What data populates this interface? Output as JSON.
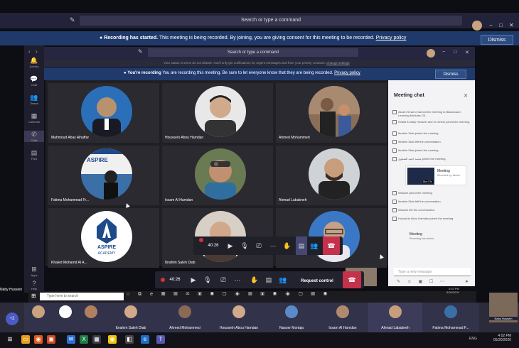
{
  "outer_window": {
    "search_placeholder": "Search or type a command",
    "banner_title": "Recording has started.",
    "banner_text": "This meeting is being recorded. By joining, you are giving consent for this meeting to be recorded.",
    "banner_link": "Privacy policy",
    "dismiss_label": "Dismiss",
    "rail": [
      {
        "icon": "bell-icon",
        "label": "Activity"
      },
      {
        "icon": "chat-icon",
        "label": "Chat"
      },
      {
        "icon": "teams-icon",
        "label": "Teams"
      },
      {
        "icon": "calendar-icon",
        "label": "Calendar"
      },
      {
        "icon": "calls-icon",
        "label": "Calls"
      },
      {
        "icon": "files-icon",
        "label": "Files"
      },
      {
        "icon": "apps-icon",
        "label": "Apps"
      },
      {
        "icon": "help-icon",
        "label": "Help"
      }
    ],
    "user_label": "Naby Hussein"
  },
  "inner_window": {
    "search_placeholder": "Search or type a command",
    "notice_text": "Your status is set to do not disturb. You'll only get notifications for urgent messages and from your priority contacts.",
    "notice_link": "Change settings",
    "banner_title": "You're recording",
    "banner_text": "You are recording this meeting. Be sure to let everyone know that they are being recorded.",
    "banner_link": "Privacy policy",
    "dismiss_label": "Dismiss"
  },
  "participants": [
    {
      "name": "Mahmoud Abas Alhaffar",
      "skin": "#b8926e",
      "bg": "#2a6fb8"
    },
    {
      "name": "Housseïn Abou Hamdan",
      "skin": "#d0aa8a",
      "bg": "#e8e8e8"
    },
    {
      "name": "Ahmed Mohammed",
      "skin": "#7a5a44",
      "bg": "#8a6e58"
    },
    {
      "name": "Fatima Mohammad Fr...",
      "skin": "#222222",
      "bg": "#3a6fa8"
    },
    {
      "name": "Issam Al Hamdan",
      "skin": "#c09070",
      "bg": "#6a7a52"
    },
    {
      "name": "Ahmad Lababneh",
      "skin": "#c79d7c",
      "bg": "#cfd3d6"
    },
    {
      "name": "Khaled Mohamd Al A...",
      "skin": "#ffffff",
      "bg": "#ffffff"
    },
    {
      "name": "Ibrahim Saleh Diab",
      "skin": "#d2a88a",
      "bg": "#d8cfc6"
    },
    {
      "name": "",
      "skin": "#c7a085",
      "bg": "#3a78c6"
    }
  ],
  "aspire_logo": {
    "line1": "ASPIRE",
    "line2": "ACADEMY"
  },
  "chat": {
    "title": "Meeting chat",
    "items": [
      "Akram Smair renamed the meeting to Blackboard Learning Modules G3.",
      "Khalid A.Naby Hussein and 21 others joined the meeting.",
      "Ibrahim Diab joined the meeting.",
      "Ibrahim Diab left the conversation.",
      "Ibrahim Diab joined the meeting.",
      "محمد احمد الصناوي joined the meeting.",
      "Wassim joined the meeting.",
      "Ibrahim Diab left the conversation.",
      "Wassim left the conversation.",
      "Housseïn Abou Hamdan joined the meeting."
    ],
    "card_title": "Meeting",
    "card_sub": "Recorded by: Akram",
    "card_duration": "54m 57s",
    "meeting_title": "Meeting",
    "meeting_sub": "Recording has started",
    "input_placeholder": "Type a new message"
  },
  "inner_controls": {
    "timer": "40:26"
  },
  "outer_controls": {
    "timer": "40:26",
    "request_control": "Request control"
  },
  "inner_taskbar": {
    "search_placeholder": "Type here to search",
    "time": "4:02 PM",
    "date": "5/20/2020"
  },
  "strip": [
    {
      "name": "",
      "skin": "#c9a27e"
    },
    {
      "name": "",
      "skin": "#ffffff"
    },
    {
      "name": "",
      "skin": "#b08060"
    },
    {
      "name": "Ibrahim Saleh Diab",
      "skin": "#d2a88a"
    },
    {
      "name": "Ahmed Mohammed",
      "skin": "#8a6a54"
    },
    {
      "name": "Housseïn Abou Hamdan",
      "skin": "#d0aa8a"
    },
    {
      "name": "Nasser Mortaja",
      "skin": "#5a8ac8"
    },
    {
      "name": "Issam Al Hamdan",
      "skin": "#b08a6e"
    },
    {
      "name": "Ahmad Lababneh",
      "skin": "#c79d7c"
    },
    {
      "name": "Fatima Mohammad F...",
      "skin": "#3a6fa8"
    }
  ],
  "strip_more": "+2",
  "self_name": "Naby Hussein",
  "taskbar": {
    "language": "ENG",
    "time": "4:02 PM",
    "date": "05/20/2020"
  }
}
